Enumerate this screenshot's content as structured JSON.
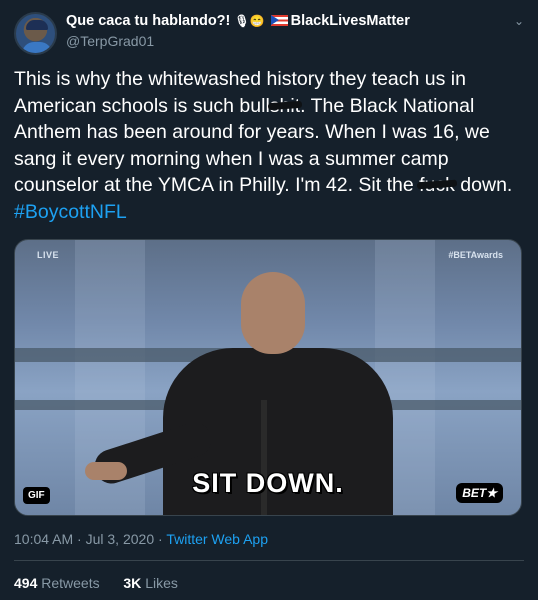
{
  "author": {
    "display_name": "Que caca tu hablando?!",
    "emojis": "🎙😁",
    "flag": "puerto-rico-flag",
    "name_suffix": "BlackLivesMatter",
    "handle": "@TerpGrad01"
  },
  "tweet": {
    "text_part1": "This is why the whitewashed history they teach us in American schools is such bull",
    "censored1": "shit",
    "text_part2": ". The Black National Anthem has been around for years. When I was 16, we sang it every morning when I was a summer camp counselor at the YMCA in Philly. I'm 42. Sit the ",
    "censored2": "fuck",
    "text_part3": " down.",
    "hashtag": "#BoycottNFL"
  },
  "media": {
    "live_label": "LIVE",
    "corner_tag": "#BETAwards",
    "caption": "SIT DOWN.",
    "gif_badge": "GIF",
    "logo": "BET★"
  },
  "meta": {
    "time": "10:04 AM",
    "sep1": " · ",
    "date": "Jul 3, 2020",
    "sep2": " · ",
    "app": "Twitter Web App"
  },
  "stats": {
    "retweets_count": "494",
    "retweets_label": "Retweets",
    "likes_count": "3K",
    "likes_label": "Likes"
  },
  "icons": {
    "more": "chevron-down-icon"
  },
  "colors": {
    "background": "#15202b",
    "link": "#1da1f2",
    "secondary_text": "#8899a6",
    "divider": "#38444d"
  }
}
